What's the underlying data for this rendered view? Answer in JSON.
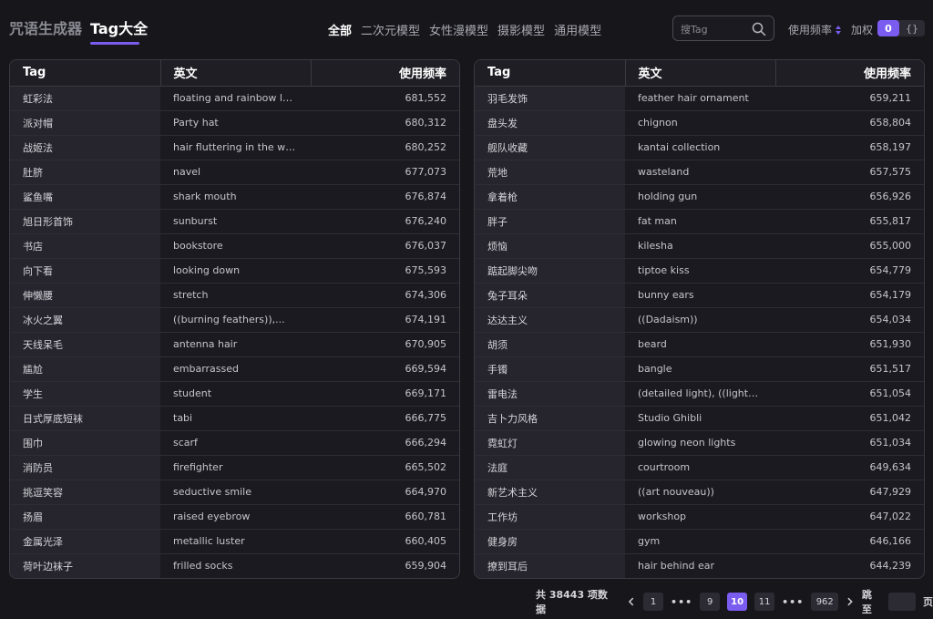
{
  "header": {
    "tabs": [
      "咒语生成器",
      "Tag大全"
    ],
    "categories": [
      "全部",
      "二次元模型",
      "女性漫模型",
      "摄影模型",
      "通用模型"
    ],
    "search_placeholder": "搜Tag",
    "sort_label": "使用频率",
    "weight_label": "加权",
    "toggle_on": "0",
    "toggle_off": "{}"
  },
  "table": {
    "columns": [
      "Tag",
      "英文",
      "使用频率"
    ],
    "left_rows": [
      [
        "虹彩法",
        "floating and rainbow lon...",
        "681,552"
      ],
      [
        "派对帽",
        "Party hat",
        "680,312"
      ],
      [
        "战姬法",
        "hair fluttering in the wind...",
        "680,252"
      ],
      [
        "肚脐",
        "navel",
        "677,073"
      ],
      [
        "鲨鱼嘴",
        "shark mouth",
        "676,874"
      ],
      [
        "旭日形首饰",
        "sunburst",
        "676,240"
      ],
      [
        "书店",
        "bookstore",
        "676,037"
      ],
      [
        "向下看",
        "looking down",
        "675,593"
      ],
      [
        "伸懒腰",
        "stretch",
        "674,306"
      ],
      [
        "冰火之翼",
        "((burning feathers)),...",
        "674,191"
      ],
      [
        "天线呆毛",
        "antenna hair",
        "670,905"
      ],
      [
        "尴尬",
        "embarrassed",
        "669,594"
      ],
      [
        "学生",
        "student",
        "669,171"
      ],
      [
        "日式厚底短袜",
        "tabi",
        "666,775"
      ],
      [
        "围巾",
        "scarf",
        "666,294"
      ],
      [
        "消防员",
        "firefighter",
        "665,502"
      ],
      [
        "挑逗笑容",
        "seductive smile",
        "664,970"
      ],
      [
        "扬眉",
        "raised eyebrow",
        "660,781"
      ],
      [
        "金属光泽",
        "metallic luster",
        "660,405"
      ],
      [
        "荷叶边袜子",
        "frilled socks",
        "659,904"
      ]
    ],
    "right_rows": [
      [
        "羽毛发饰",
        "feather hair ornament",
        "659,211"
      ],
      [
        "盘头发",
        "chignon",
        "658,804"
      ],
      [
        "舰队收藏",
        "kantai collection",
        "658,197"
      ],
      [
        "荒地",
        "wasteland",
        "657,575"
      ],
      [
        "拿着枪",
        "holding gun",
        "656,926"
      ],
      [
        "胖子",
        "fat man",
        "655,817"
      ],
      [
        "烦恼",
        "kilesha",
        "655,000"
      ],
      [
        "踮起脚尖吻",
        "tiptoe kiss",
        "654,779"
      ],
      [
        "兔子耳朵",
        "bunny ears",
        "654,179"
      ],
      [
        "达达主义",
        "((Dadaism))",
        "654,034"
      ],
      [
        "胡须",
        "beard",
        "651,930"
      ],
      [
        "手镯",
        "bangle",
        "651,517"
      ],
      [
        "雷电法",
        "(detailed light), ((lightnin...",
        "651,054"
      ],
      [
        "吉卜力风格",
        "Studio Ghibli",
        "651,042"
      ],
      [
        "霓虹灯",
        "glowing neon lights",
        "651,034"
      ],
      [
        "法庭",
        "courtroom",
        "649,634"
      ],
      [
        "新艺术主义",
        "((art nouveau))",
        "647,929"
      ],
      [
        "工作坊",
        "workshop",
        "647,022"
      ],
      [
        "健身房",
        "gym",
        "646,166"
      ],
      [
        "撩到耳后",
        "hair behind ear",
        "644,239"
      ]
    ]
  },
  "pagination": {
    "total_text": "共 38443 项数据",
    "pages": [
      "1",
      "9",
      "10",
      "11",
      "962"
    ],
    "current": "10",
    "jump_label": "跳至",
    "page_unit": "页"
  },
  "colors": {
    "accent": "#7b5cf0",
    "background": "#17161b"
  }
}
